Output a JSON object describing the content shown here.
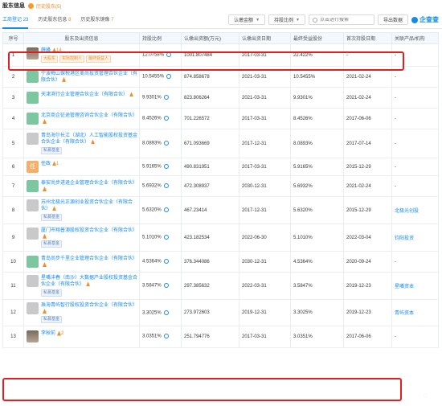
{
  "header": {
    "section_title": "股东信息",
    "history_link": "历史股东(5)"
  },
  "tabs": [
    {
      "label": "工商登记",
      "count": "23"
    },
    {
      "label": "历史股东信息",
      "count": "8"
    },
    {
      "label": "历史股东镜像",
      "count": "7"
    }
  ],
  "toolbar": {
    "amount_filter": "认缴金额",
    "ratio_filter": "持股比例",
    "search_placeholder": "点击进行搜索",
    "export_label": "导出数据",
    "logo_text": "企查查"
  },
  "columns": [
    "序号",
    "股东及出资信息",
    "持股比例",
    "认缴出资额(万元)",
    "认缴出资日期",
    "最终受益股份",
    "首次持股日期",
    "关联产品/机构"
  ],
  "rows": [
    {
      "no": "1",
      "name": "薛峰",
      "tag": "14",
      "avatar": "person",
      "badges": [
        "大股东",
        "实际控制人",
        "最终受益人"
      ],
      "ratio": "12.0758%",
      "amount": "1001.807484",
      "date": "2017-03-31",
      "benefit": "22.422%",
      "first": "-",
      "related": "-"
    },
    {
      "no": "2",
      "name": "宁波梅山保税港区美尚投资管理合伙企业（有限合伙）",
      "avatar": "org",
      "badges": [],
      "ratio": "10.5455%",
      "amount": "874.858678",
      "date": "2021-03-31",
      "benefit": "10.5455%",
      "first": "2021-02-24",
      "related": "-"
    },
    {
      "no": "3",
      "name": "天津滨行企业管理合伙企业（有限合伙）",
      "avatar": "org",
      "badges": [],
      "ratio": "9.9301%",
      "amount": "823.806264",
      "date": "2021-03-31",
      "benefit": "9.9301%",
      "first": "2021-02-24",
      "related": "-"
    },
    {
      "no": "4",
      "name": "北京商企征途管理咨询合伙企业（有限合伙）",
      "avatar": "org",
      "badges": [],
      "ratio": "8.4526%",
      "amount": "701.226572",
      "date": "2017-03-31",
      "benefit": "8.4526%",
      "first": "2017-06-06",
      "related": "-"
    },
    {
      "no": "5",
      "name": "青岛海尔长江（湖北）人工智能股权投资基金合伙企业（有限合伙）",
      "avatar": "gray",
      "badges": [
        "私募基金"
      ],
      "ratio": "8.0893%",
      "amount": "671.093669",
      "date": "2017-12-31",
      "benefit": "8.0893%",
      "first": "2017-07-14",
      "related": "-"
    },
    {
      "no": "6",
      "name": "任政",
      "tag": "1",
      "avatar": "orange",
      "initial": "任",
      "badges": [],
      "ratio": "5.9165%",
      "amount": "490.831951",
      "date": "2017-03-31",
      "benefit": "5.9165%",
      "first": "2015-12-29",
      "related": "-"
    },
    {
      "no": "7",
      "name": "泰安尚步进退企业管理合伙企业（有限合伙）",
      "avatar": "org",
      "badges": [],
      "ratio": "5.6932%",
      "amount": "472.308937",
      "date": "2030-12-31",
      "benefit": "5.6932%",
      "first": "2021-02-24",
      "related": "-"
    },
    {
      "no": "8",
      "name": "苏州北极光正源创业投资合伙企业（有限合伙）",
      "avatar": "gray",
      "badges": [
        "私募基金"
      ],
      "ratio": "5.6320%",
      "amount": "467.23414",
      "date": "2017-12-31",
      "benefit": "5.6320%",
      "first": "2015-12-29",
      "related": "北极光创投"
    },
    {
      "no": "9",
      "name": "厦门市翔普澳股权投资合伙企业（有限合伙）",
      "avatar": "gray",
      "badges": [
        "私募基金"
      ],
      "ratio": "5.1010%",
      "amount": "423.182534",
      "date": "2022-06-30",
      "benefit": "5.1010%",
      "first": "2022-03-04",
      "related": "钧阳投资"
    },
    {
      "no": "10",
      "name": "青岛尚步千里企业管理合伙企业（有限合伙）",
      "avatar": "org",
      "badges": [],
      "ratio": "4.5364%",
      "amount": "376.344086",
      "date": "2030-12-31",
      "benefit": "4.5364%",
      "first": "2020-09-24",
      "related": "-"
    },
    {
      "no": "11",
      "name": "星嘴沣春（南沙）大数据产业股权投资基金合伙企业（有限合伙）",
      "avatar": "gray",
      "badges": [
        "私募基金"
      ],
      "ratio": "3.5847%",
      "amount": "297.385632",
      "date": "2022-03-31",
      "benefit": "3.5847%",
      "first": "2019-12-23",
      "related": "星嘴资本"
    },
    {
      "no": "12",
      "name": "珠海青屿智行股权投资合伙企业（有限合伙）",
      "avatar": "gray",
      "badges": [
        "私募基金"
      ],
      "ratio": "3.3025%",
      "amount": "273.972603",
      "date": "2019-12-31",
      "benefit": "3.3025%",
      "first": "2019-12-23",
      "related": "青屿资本"
    },
    {
      "no": "13",
      "name": "李秋前",
      "tag": "2",
      "avatar": "person",
      "badges": [],
      "ratio": "3.0351%",
      "amount": "251.794776",
      "date": "2017-03-31",
      "benefit": "3.0351%",
      "first": "2017-06-06",
      "related": "-"
    }
  ],
  "colors": {
    "accent": "#128bed",
    "highlight": "#e02020",
    "warn": "#f08c2b"
  }
}
